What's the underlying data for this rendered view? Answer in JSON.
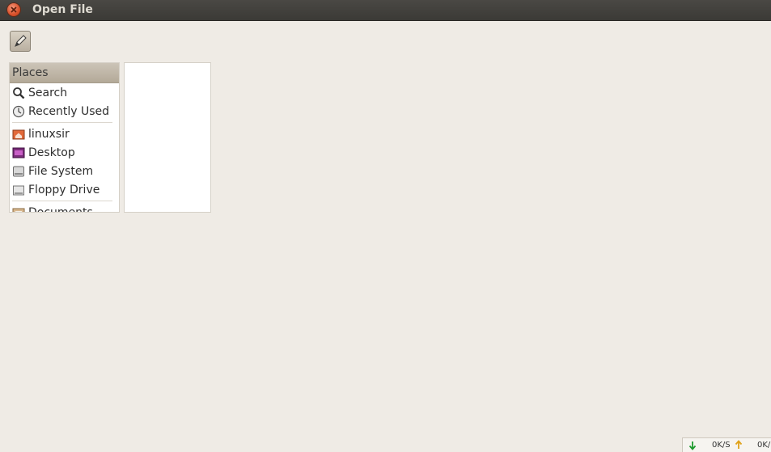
{
  "window": {
    "title": "Open File"
  },
  "toolbar": {
    "edit_location_icon": "pencil-icon"
  },
  "places": {
    "header": "Places",
    "items": [
      {
        "label": "Search",
        "icon": "search-icon"
      },
      {
        "label": "Recently Used",
        "icon": "recent-clock-icon"
      },
      {
        "label": "linuxsir",
        "icon": "home-folder-icon"
      },
      {
        "label": "Desktop",
        "icon": "desktop-icon"
      },
      {
        "label": "File System",
        "icon": "hard-drive-icon"
      },
      {
        "label": "Floppy Drive",
        "icon": "floppy-drive-icon"
      },
      {
        "label": "Documents",
        "icon": "documents-folder-icon"
      }
    ]
  },
  "netspeed": {
    "down": "0K/S",
    "up": "0K/"
  }
}
